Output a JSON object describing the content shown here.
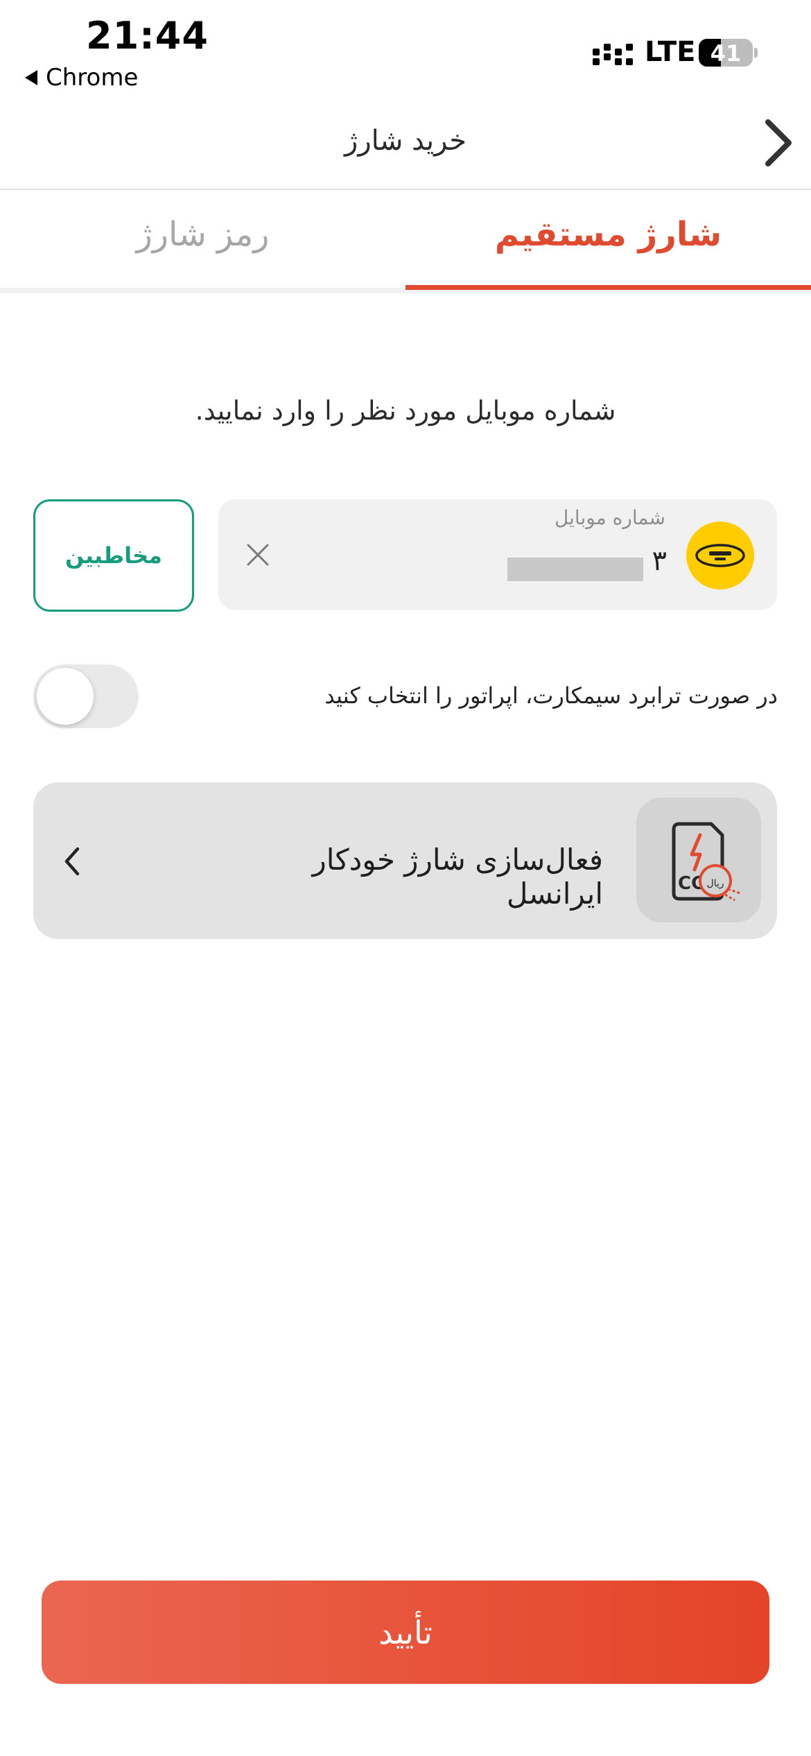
{
  "status_bar": {
    "time": "21:44",
    "back_app": "Chrome",
    "network": "LTE",
    "battery": "41",
    "battery_level_percent": 41,
    "icons": [
      "signal-icon",
      "battery-icon"
    ]
  },
  "header": {
    "title": "خرید شارژ",
    "back_icon": "chevron-right-icon"
  },
  "tabs": [
    {
      "label": "شارژ مستقیم",
      "active": true
    },
    {
      "label": "رمز شارژ",
      "active": false
    }
  ],
  "form": {
    "instruction": "شماره موبایل مورد نظر را وارد نمایید.",
    "phone_field": {
      "label": "شماره موبایل",
      "value": "۳",
      "operator_logo": "irancell-logo-icon",
      "clear_icon": "close-icon"
    },
    "contacts_button": "مخاطبین",
    "toggle": {
      "label": "در صورت ترابرد سیمکارت، اپراتور را انتخاب کنید",
      "on": false
    }
  },
  "auto_charge": {
    "title": "فعال‌سازی شارژ خودکار ایرانسل",
    "icon": "sim-charge-icon",
    "icon_text": "ریال",
    "chevron": "chevron-left-icon"
  },
  "confirm_button": "تأیید",
  "colors": {
    "accent": "#e04a2f",
    "contacts": "#179c7f",
    "operator_yellow": "#ffcc00",
    "card_bg": "#e3e3e3",
    "field_bg": "#f1f1f1"
  }
}
